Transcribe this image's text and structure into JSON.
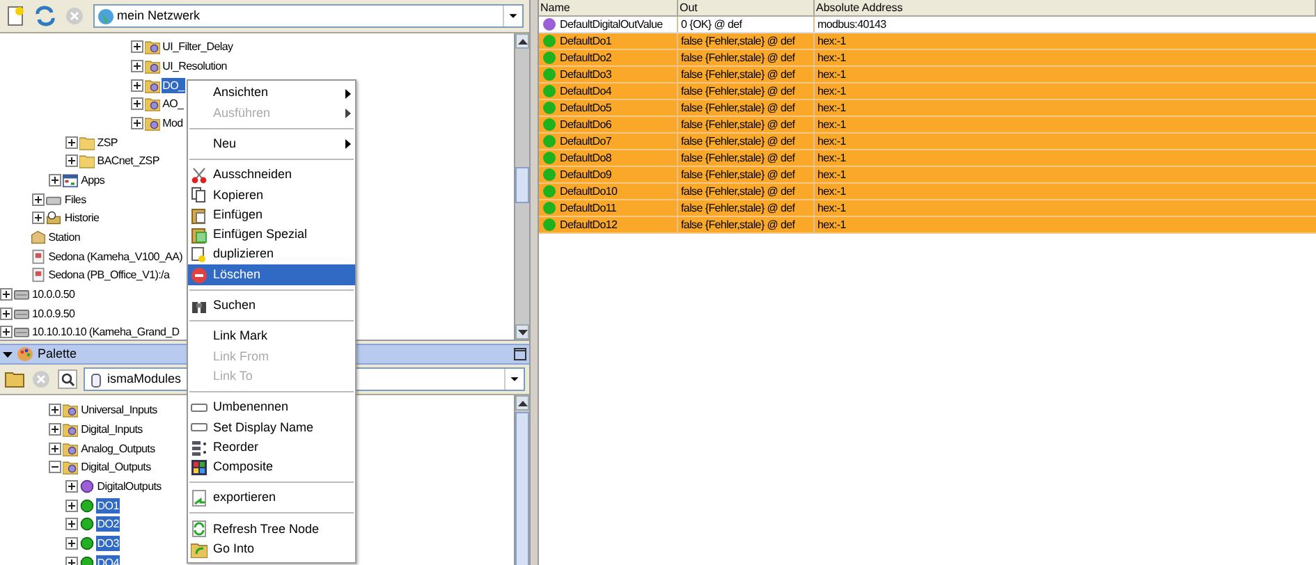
{
  "nav": {
    "combo": "mein Netzwerk",
    "tree": [
      {
        "children": [
          {
            "children": [
              {
                "children": [
                  {
                    "children": [
                      {
                        "children": [
                          {
                            "children": [
                              {
                                "children": [
                                  {
                                    "children": [
                                      {
                                        "label": "UI_Filter_Delay",
                                        "kind": "module-folder",
                                        "expanded": false,
                                        "selected": false
                                      },
                                      {
                                        "label": "UI_Resolution",
                                        "kind": "module-folder",
                                        "expanded": false,
                                        "selected": false
                                      },
                                      {
                                        "label": "DO_",
                                        "kind": "module-folder",
                                        "expanded": false,
                                        "selected": true
                                      },
                                      {
                                        "label": "AO_",
                                        "kind": "module-folder",
                                        "expanded": false,
                                        "selected": false
                                      },
                                      {
                                        "label": "Mod",
                                        "kind": "module-folder",
                                        "expanded": false,
                                        "selected": false
                                      }
                                    ]
                                  }
                                ]
                              }
                            ]
                          }
                        ]
                      },
                      {
                        "label": "ZSP",
                        "kind": "folder",
                        "expanded": false,
                        "selected": false
                      },
                      {
                        "label": "BACnet_ZSP",
                        "kind": "folder",
                        "expanded": false,
                        "selected": false
                      }
                    ]
                  },
                  {
                    "label": "Apps",
                    "kind": "apps",
                    "expanded": false,
                    "selected": false
                  }
                ]
              },
              {
                "label": "Files",
                "kind": "files",
                "expanded": false,
                "selected": false
              },
              {
                "label": "Historie",
                "kind": "history",
                "expanded": false,
                "selected": false
              }
            ]
          },
          {
            "label": "Station",
            "kind": "station",
            "selected": false
          },
          {
            "label": "Sedona (Kameha_V100_AA)",
            "kind": "sedona",
            "selected": false
          },
          {
            "label": "Sedona (PB_Office_V1):/a",
            "kind": "sedona",
            "selected": false
          }
        ]
      },
      {
        "label": "10.0.0.50",
        "kind": "host",
        "expanded": false,
        "selected": false
      },
      {
        "label": "10.0.9.50",
        "kind": "host",
        "expanded": false,
        "selected": false
      },
      {
        "label": "10.10.10.10 (Kameha_Grand_D",
        "kind": "host",
        "expanded": false,
        "selected": false
      }
    ]
  },
  "palette": {
    "title": "Palette",
    "combo": "ismaModules",
    "tree": [
      {
        "children": [
          {
            "children": [
              {
                "children": [
                  {
                    "label": "Universal_Inputs",
                    "kind": "module-folder",
                    "expanded": false,
                    "selected": false
                  },
                  {
                    "label": "Digital_Inputs",
                    "kind": "module-folder",
                    "expanded": false,
                    "selected": false
                  },
                  {
                    "label": "Analog_Outputs",
                    "kind": "module-folder",
                    "expanded": false,
                    "selected": false
                  },
                  {
                    "label": "Digital_Outputs",
                    "kind": "module-folder",
                    "expanded": true,
                    "selected": false,
                    "children": [
                      {
                        "label": "DigitalOutputs",
                        "kind": "purple-point",
                        "expanded": false,
                        "selected": false
                      },
                      {
                        "label": "DO1",
                        "kind": "green-point",
                        "expanded": false,
                        "selected": true
                      },
                      {
                        "label": "DO2",
                        "kind": "green-point",
                        "expanded": false,
                        "selected": true
                      },
                      {
                        "label": "DO3",
                        "kind": "green-point",
                        "expanded": false,
                        "selected": true
                      },
                      {
                        "label": "DO4",
                        "kind": "green-point",
                        "expanded": false,
                        "selected": true
                      }
                    ]
                  }
                ]
              }
            ]
          }
        ]
      }
    ]
  },
  "menu": [
    {
      "kind": "plain",
      "label": "Ansichten",
      "submenu": true,
      "disabled": false,
      "selected": false
    },
    {
      "kind": "plain",
      "label": "Ausführen",
      "submenu": true,
      "disabled": true,
      "selected": false
    },
    {
      "kind": "separator"
    },
    {
      "kind": "plain",
      "label": "Neu",
      "submenu": true,
      "disabled": false,
      "selected": false
    },
    {
      "kind": "separator"
    },
    {
      "kind": "cut",
      "label": "Ausschneiden",
      "submenu": false,
      "disabled": false,
      "selected": false
    },
    {
      "kind": "copy",
      "label": "Kopieren",
      "submenu": false,
      "disabled": false,
      "selected": false
    },
    {
      "kind": "paste",
      "label": "Einfügen",
      "submenu": false,
      "disabled": false,
      "selected": false
    },
    {
      "kind": "paste-special",
      "label": "Einfügen Spezial",
      "submenu": false,
      "disabled": false,
      "selected": false
    },
    {
      "kind": "duplicate",
      "label": "duplizieren",
      "submenu": false,
      "disabled": false,
      "selected": false
    },
    {
      "kind": "delete",
      "label": "Löschen",
      "submenu": false,
      "disabled": false,
      "selected": true
    },
    {
      "kind": "separator"
    },
    {
      "kind": "find",
      "label": "Suchen",
      "submenu": false,
      "disabled": false,
      "selected": false
    },
    {
      "kind": "separator"
    },
    {
      "kind": "plain",
      "label": "Link Mark",
      "submenu": false,
      "disabled": false,
      "selected": false
    },
    {
      "kind": "plain",
      "label": "Link From",
      "submenu": false,
      "disabled": true,
      "selected": false
    },
    {
      "kind": "plain",
      "label": "Link To",
      "submenu": false,
      "disabled": true,
      "selected": false
    },
    {
      "kind": "separator"
    },
    {
      "kind": "rename",
      "label": "Umbenennen",
      "submenu": false,
      "disabled": false,
      "selected": false
    },
    {
      "kind": "rename",
      "label": "Set Display Name",
      "submenu": false,
      "disabled": false,
      "selected": false
    },
    {
      "kind": "reorder",
      "label": "Reorder",
      "submenu": false,
      "disabled": false,
      "selected": false
    },
    {
      "kind": "composite",
      "label": "Composite",
      "submenu": false,
      "disabled": false,
      "selected": false
    },
    {
      "kind": "separator"
    },
    {
      "kind": "export",
      "label": "exportieren",
      "submenu": false,
      "disabled": false,
      "selected": false
    },
    {
      "kind": "separator"
    },
    {
      "kind": "refresh",
      "label": "Refresh Tree Node",
      "submenu": false,
      "disabled": false,
      "selected": false
    },
    {
      "kind": "go-into",
      "label": "Go Into",
      "submenu": false,
      "disabled": false,
      "selected": false
    }
  ],
  "table": {
    "columns": [
      "Name",
      "Out",
      "Absolute Address"
    ],
    "rows": [
      {
        "name": "DefaultDigitalOutValue",
        "color": "#9b5fd6",
        "out": "0 {OK} @ def",
        "address": "modbus:40143",
        "stale": false
      },
      {
        "name": "DefaultDo1",
        "color": "#1fb21f",
        "out": "false {Fehler,stale} @ def",
        "address": "hex:-1",
        "stale": true
      },
      {
        "name": "DefaultDo2",
        "color": "#1fb21f",
        "out": "false {Fehler,stale} @ def",
        "address": "hex:-1",
        "stale": true
      },
      {
        "name": "DefaultDo3",
        "color": "#1fb21f",
        "out": "false {Fehler,stale} @ def",
        "address": "hex:-1",
        "stale": true
      },
      {
        "name": "DefaultDo4",
        "color": "#1fb21f",
        "out": "false {Fehler,stale} @ def",
        "address": "hex:-1",
        "stale": true
      },
      {
        "name": "DefaultDo5",
        "color": "#1fb21f",
        "out": "false {Fehler,stale} @ def",
        "address": "hex:-1",
        "stale": true
      },
      {
        "name": "DefaultDo6",
        "color": "#1fb21f",
        "out": "false {Fehler,stale} @ def",
        "address": "hex:-1",
        "stale": true
      },
      {
        "name": "DefaultDo7",
        "color": "#1fb21f",
        "out": "false {Fehler,stale} @ def",
        "address": "hex:-1",
        "stale": true
      },
      {
        "name": "DefaultDo8",
        "color": "#1fb21f",
        "out": "false {Fehler,stale} @ def",
        "address": "hex:-1",
        "stale": true
      },
      {
        "name": "DefaultDo9",
        "color": "#1fb21f",
        "out": "false {Fehler,stale} @ def",
        "address": "hex:-1",
        "stale": true
      },
      {
        "name": "DefaultDo10",
        "color": "#1fb21f",
        "out": "false {Fehler,stale} @ def",
        "address": "hex:-1",
        "stale": true
      },
      {
        "name": "DefaultDo11",
        "color": "#1fb21f",
        "out": "false {Fehler,stale} @ def",
        "address": "hex:-1",
        "stale": true
      },
      {
        "name": "DefaultDo12",
        "color": "#1fb21f",
        "out": "false {Fehler,stale} @ def",
        "address": "hex:-1",
        "stale": true
      }
    ]
  }
}
